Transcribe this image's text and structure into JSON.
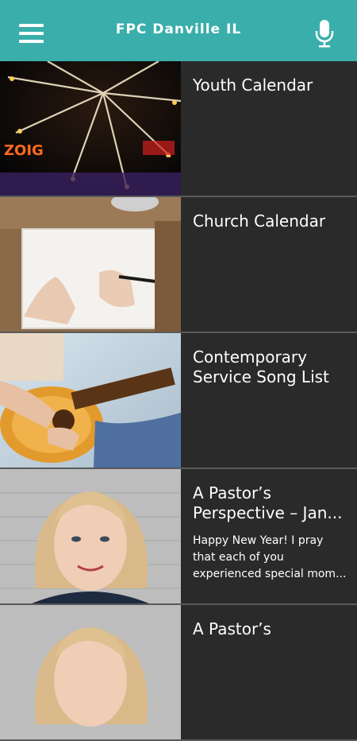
{
  "header": {
    "title": "FPC Danville IL",
    "menu_icon": "hamburger-menu-icon",
    "mic_icon": "microphone-icon",
    "bg_color": "#3aaeaa"
  },
  "items": [
    {
      "title": "Youth Calendar",
      "description": "",
      "image": "ferris-wheel-photo"
    },
    {
      "title": "Church Calendar",
      "description": "",
      "image": "writing-notebook-photo"
    },
    {
      "title": "Contemporary Service Song List",
      "description": "",
      "image": "guitar-player-photo"
    },
    {
      "title": "A Pastor’s Perspective – Jan...",
      "description": "Happy New Year! I pray that each of you experienced special mom...",
      "image": "pastor-portrait-photo"
    },
    {
      "title": "A Pastor’s",
      "description": "",
      "image": "pastor-portrait-photo"
    }
  ]
}
